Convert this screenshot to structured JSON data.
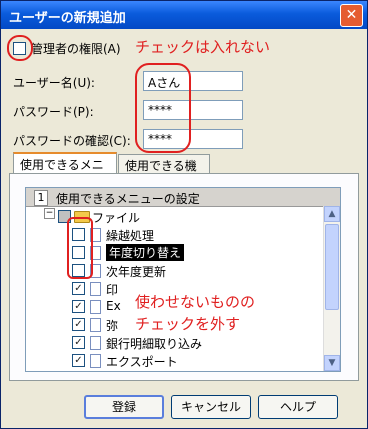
{
  "window": {
    "title": "ユーザーの新規追加",
    "close_glyph": "✕"
  },
  "form": {
    "admin_label": "管理者の権限(A)",
    "username_label": "ユーザー名(U):",
    "username_value": "Aさん",
    "password_label": "パスワード(P):",
    "password_value": "****",
    "confirm_label": "パスワードの確認(C):",
    "confirm_value": "****"
  },
  "annotations": {
    "top_note": "チェックは入れない",
    "side_note_line1": "使わせないものの",
    "side_note_line2": "チェックを外す",
    "color": "#e02020"
  },
  "tabs": [
    {
      "label": "使用できるメニュー",
      "active": true
    },
    {
      "label": "使用できる機能",
      "active": false
    }
  ],
  "menu_list": {
    "header_num": "1",
    "header_text": "使用できるメニューの設定",
    "root_label": "ファイル",
    "expander": "−",
    "items": [
      {
        "label": "繰越処理",
        "checked": false
      },
      {
        "label": "年度切り替え",
        "checked": false,
        "selected": true
      },
      {
        "label": "次年度更新",
        "checked": false
      },
      {
        "label": "印",
        "checked": true
      },
      {
        "label": "Ex",
        "checked": true
      },
      {
        "label": "弥",
        "checked": true
      },
      {
        "label": "銀行明細取り込み",
        "checked": true
      },
      {
        "label": "エクスポート",
        "checked": true
      }
    ],
    "check_glyph": "✓"
  },
  "scrollbar": {
    "up_glyph": "▲",
    "down_glyph": "▼"
  },
  "buttons": {
    "register": "登録",
    "cancel": "キャンセル",
    "help": "ヘルプ"
  }
}
